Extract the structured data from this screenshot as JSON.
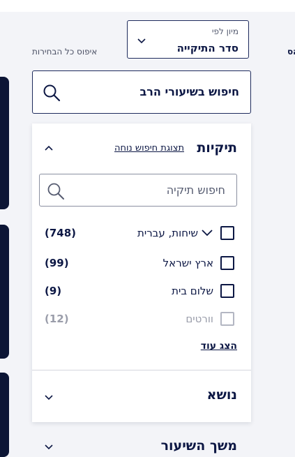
{
  "sort": {
    "label": "מיון לפי",
    "value": "סדר התיקייה"
  },
  "reset_label": "איפוס כל הבחירות",
  "edge_text": "הס",
  "search": {
    "placeholder": "חיפוש בשיעורי הרב"
  },
  "folders_section": {
    "title": "תיקיות",
    "friendly_view_link": "תצוגת חיפוש נוחה",
    "search_placeholder": "חיפוש תיקיה",
    "items": [
      {
        "label": "שיחות, עברית",
        "count": "(748)",
        "checked": false,
        "expandable": true,
        "disabled": false
      },
      {
        "label": "ארץ ישראל",
        "count": "(99)",
        "checked": false,
        "expandable": false,
        "disabled": false
      },
      {
        "label": "שלום בית",
        "count": "(9)",
        "checked": false,
        "expandable": false,
        "disabled": false
      },
      {
        "label": "וורטים",
        "count": "(12)",
        "checked": false,
        "expandable": false,
        "disabled": true
      }
    ],
    "show_more": "הצג עוד"
  },
  "topic_section": {
    "title": "נושא"
  },
  "lesson_length_section": {
    "title": "משך השיעור"
  },
  "icons": {
    "search": "search-icon",
    "chevron_up": "chevron-up-icon",
    "chevron_down": "chevron-down-icon"
  },
  "colors": {
    "primary": "#0c1744",
    "background": "#f3f4f8",
    "dark_panel": "#0c1535"
  }
}
